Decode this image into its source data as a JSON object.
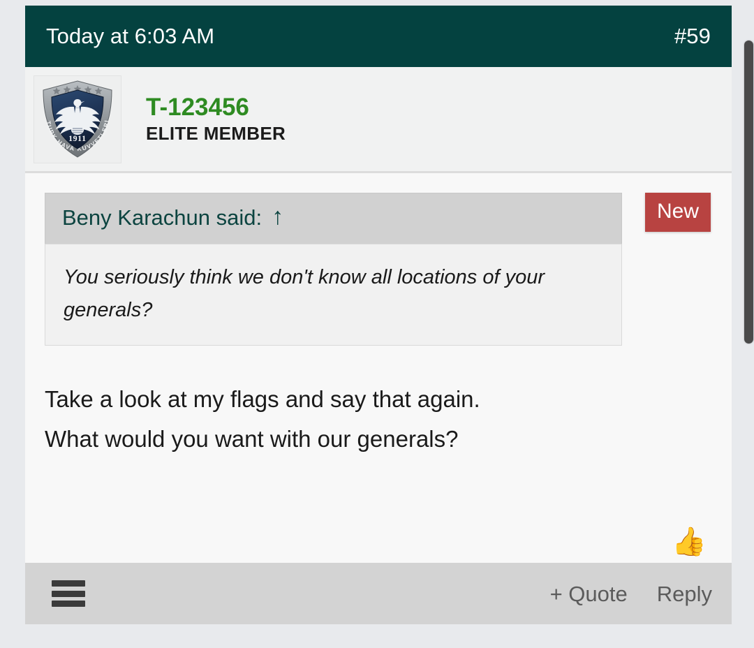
{
  "page": {
    "background_color": "#e8eaed"
  },
  "post": {
    "header": {
      "timestamp": "Today at 6:03 AM",
      "post_number": "#59",
      "background_color": "#044240",
      "text_color": "#ffffff"
    },
    "author": {
      "username": "T-123456",
      "username_color": "#2e8b22",
      "user_title": "ELITE MEMBER",
      "avatar": {
        "icon_name": "turkish-air-force-emblem",
        "crest_year": "1911",
        "crest_text": "TURK HAVA KUVVETLERI",
        "shield_color": "#1b3151",
        "border_color": "#8e9398"
      }
    },
    "badge": {
      "label": "New",
      "color": "#b84341"
    },
    "quote": {
      "attribution": "Beny Karachun said:",
      "jump_icon": "↑",
      "text": "You seriously think we don't know all locations of your generals?",
      "header_background": "#d1d1d1",
      "body_background": "#f1f1f1"
    },
    "body": {
      "lines": [
        "Take a look at my flags and say that again.",
        "What would you want with our generals?"
      ]
    },
    "reaction": {
      "emoji": "👍",
      "name": "thumbs-up-emoji"
    },
    "footer": {
      "menu_icon": "hamburger-menu-icon",
      "quote_label": "+ Quote",
      "reply_label": "Reply",
      "background_color": "#d3d3d3",
      "link_color": "#5b5b5b"
    }
  },
  "scrollbar": {
    "name": "vertical-scrollbar",
    "thumb_color": "#4a4a4a"
  }
}
